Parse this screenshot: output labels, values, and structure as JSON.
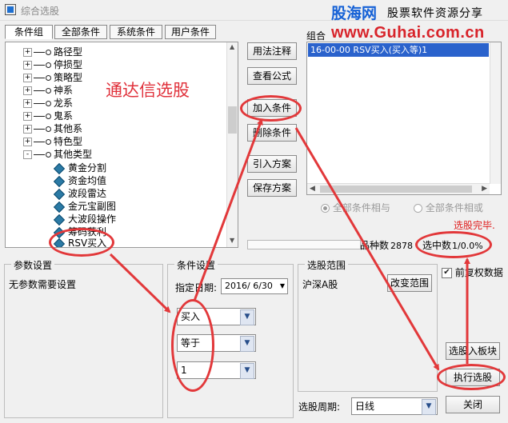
{
  "window": {
    "title": "综合选股"
  },
  "watermark": {
    "brand": "股海网",
    "slogan": "股票软件资源分享",
    "url": "www.Guhai.com.cn"
  },
  "tabs": [
    "条件组",
    "全部条件",
    "系统条件",
    "用户条件"
  ],
  "tree": {
    "categories": [
      {
        "label": "路径型",
        "expand": "+"
      },
      {
        "label": "停损型",
        "expand": "+"
      },
      {
        "label": "策略型",
        "expand": "+"
      },
      {
        "label": "神系",
        "expand": "+"
      },
      {
        "label": "龙系",
        "expand": "+"
      },
      {
        "label": "鬼系",
        "expand": "+"
      },
      {
        "label": "其他系",
        "expand": "+"
      },
      {
        "label": "特色型",
        "expand": "+"
      },
      {
        "label": "其他类型",
        "expand": "-"
      }
    ],
    "children": [
      "黄金分割",
      "资金均值",
      "波段雷达",
      "金元宝副图",
      "大波段操作",
      "筹码获利",
      "RSV买入"
    ]
  },
  "annotation": "通达信选股",
  "buttons": {
    "usage": "用法注释",
    "view_formula": "查看公式",
    "add_condition": "加入条件",
    "delete_condition": "删除条件",
    "import_scheme": "引入方案",
    "save_scheme": "保存方案",
    "change_range": "改变范围",
    "to_sector": "选股入板块",
    "execute": "执行选股",
    "close": "关闭"
  },
  "condition_combo": {
    "label": "组合",
    "items": [
      "16-00-00 RSV买入(买入等)1"
    ]
  },
  "logic": {
    "and": "全部条件相与",
    "or": "全部条件相或"
  },
  "status": {
    "done": "选股完毕.",
    "count_label": "品种数",
    "count_value": "2878",
    "selected_label": "选中数",
    "selected_value": "1/0.0%"
  },
  "params": {
    "title": "参数设置",
    "text": "无参数需要设置"
  },
  "condition_settings": {
    "title": "条件设置",
    "date_label": "指定日期:",
    "date_value": "2016/ 6/30",
    "select1": "买入",
    "select2": "等于",
    "select3": "1"
  },
  "range": {
    "title": "选股范围",
    "value": "沪深A股"
  },
  "adjust": {
    "label": "前复权数据",
    "checked": true
  },
  "period": {
    "label": "选股周期:",
    "value": "日线"
  },
  "colors": {
    "accent": "#2a62cc",
    "annotation": "#e2383a",
    "brand_blue": "#1561d6",
    "brand_red": "#d8232a"
  }
}
